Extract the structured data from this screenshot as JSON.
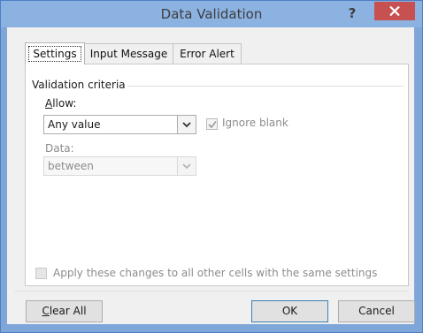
{
  "dialog": {
    "title": "Data Validation",
    "help_label": "?"
  },
  "tabs": [
    {
      "label": "Settings",
      "active": true
    },
    {
      "label": "Input Message",
      "active": false
    },
    {
      "label": "Error Alert",
      "active": false
    }
  ],
  "settings": {
    "group_label": "Validation criteria",
    "allow_label": "Allow:",
    "allow_mnemonic": "A",
    "allow_rest": "llow:",
    "allow_value": "Any value",
    "ignore_blank_label": "Ignore blank",
    "ignore_blank_checked": true,
    "data_label": "Data:",
    "data_value": "between",
    "apply_all_label": "Apply these changes to all other cells with the same settings",
    "apply_all_checked": false
  },
  "buttons": {
    "clear_all_mnemonic": "C",
    "clear_all_rest": "lear All",
    "ok": "OK",
    "cancel": "Cancel"
  },
  "colors": {
    "titlebar": "#8cb2e2",
    "close_button": "#c75050",
    "dialog_background": "#f0f0f0"
  }
}
